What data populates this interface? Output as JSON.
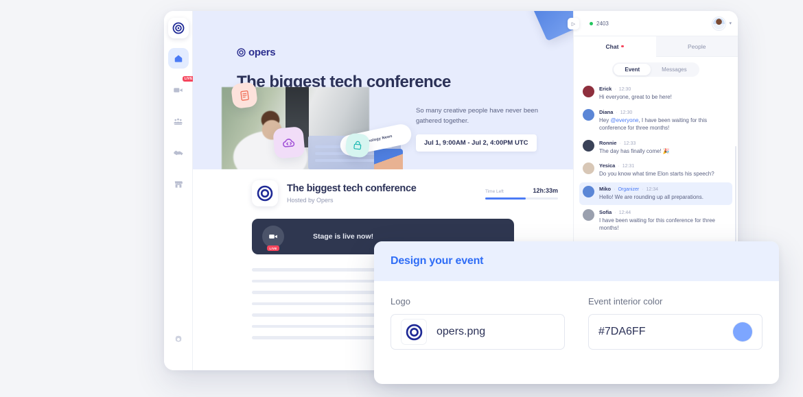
{
  "sidebar": {
    "items": [
      {
        "name": "brand-logo",
        "icon": "opers-logo-icon",
        "active": false
      },
      {
        "name": "home",
        "icon": "home-icon",
        "active": true
      },
      {
        "name": "stage",
        "icon": "video-camera-icon",
        "active": false,
        "badge": "LIVE"
      },
      {
        "name": "sessions",
        "icon": "audience-icon",
        "active": false
      },
      {
        "name": "networking",
        "icon": "handshake-icon",
        "active": false
      },
      {
        "name": "expo",
        "icon": "booth-icon",
        "active": false
      }
    ],
    "settings": {
      "name": "settings",
      "icon": "gear-icon"
    }
  },
  "banner": {
    "brand": "opers",
    "title": "The biggest tech conference",
    "subtitle": "So many creative people have never been gathered together.",
    "date_badge": "Jul 1, 9:00AM - Jul 2, 4:00PM UTC",
    "news_card": "Technology News",
    "background_color": "#E7ECFD"
  },
  "event_header": {
    "name": "The biggest tech conference",
    "host": "Hosted by Opers",
    "time_left_label": "Time Left",
    "time_left_value": "12h:33m",
    "progress_percent": 56
  },
  "stage": {
    "text": "Stage is live now!",
    "live_badge": "LIVE",
    "icon": "video-camera-icon"
  },
  "chat": {
    "viewer_count": "2403",
    "tabs": [
      {
        "label": "Chat",
        "active": true,
        "dot": true
      },
      {
        "label": "People",
        "active": false,
        "dot": false
      }
    ],
    "filters": [
      {
        "label": "Event",
        "active": true
      },
      {
        "label": "Messages",
        "active": false
      }
    ],
    "messages": [
      {
        "name": "Erick",
        "role": "",
        "time": "12:30",
        "text": "Hi everyone, great to be here!",
        "avatar_color": "#8e2f3d",
        "highlight": false
      },
      {
        "name": "Diana",
        "role": "",
        "time": "12:30",
        "text_before": "Hey ",
        "mention": "@everyone",
        "text_after": ", I have been waiting for this conference for three months!",
        "avatar_color": "#5b86d6",
        "highlight": false
      },
      {
        "name": "Ronnie",
        "role": "",
        "time": "12:33",
        "text": "The day has finally come! 🎉",
        "avatar_color": "#3a4258",
        "highlight": false
      },
      {
        "name": "Yesica",
        "role": "",
        "time": "12:31",
        "text": "Do you know what time Elon starts his speech?",
        "avatar_color": "#d8c7b6",
        "highlight": false
      },
      {
        "name": "Miko",
        "role": "Organizer",
        "time": "12:34",
        "text": "Hello! We are rounding up all preparations.",
        "avatar_color": "#5b86d6",
        "highlight": true
      },
      {
        "name": "Sofia",
        "role": "",
        "time": "12:44",
        "text": "I have been waiting for this conference for three months!",
        "avatar_color": "#9aa0ae",
        "highlight": false
      }
    ]
  },
  "design_modal": {
    "title": "Design your event",
    "logo_label": "Logo",
    "logo_filename": "opers.png",
    "color_label": "Event interior color",
    "color_value": "#7DA6FF",
    "color_swatch": "#7DA6FF"
  }
}
